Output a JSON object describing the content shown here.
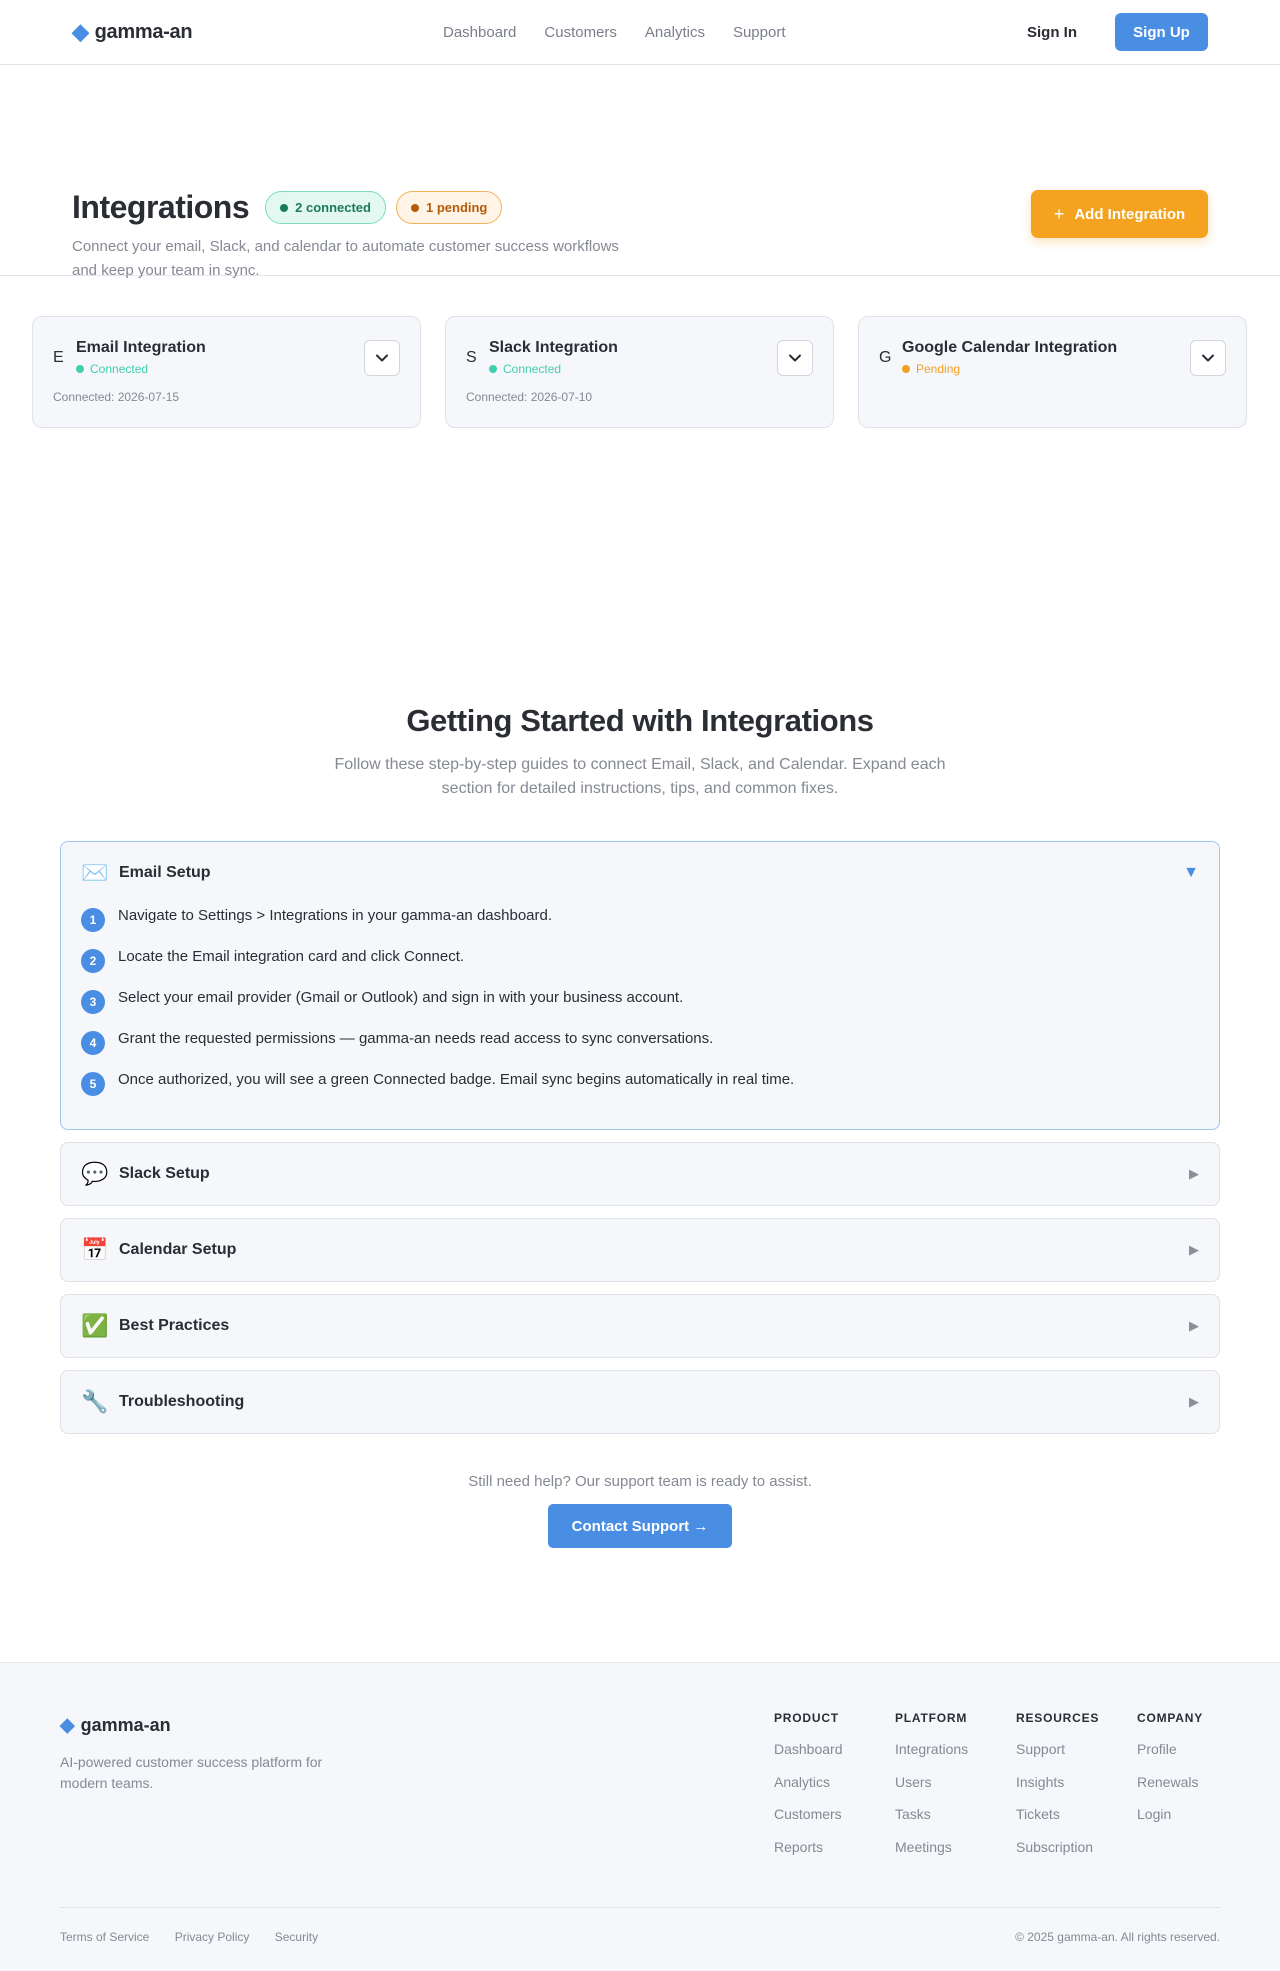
{
  "brand": {
    "name": "gamma-an",
    "accent": "#4a8ee3"
  },
  "nav": {
    "links": [
      "Dashboard",
      "Customers",
      "Analytics",
      "Support"
    ],
    "sign_in": "Sign In",
    "sign_up": "Sign Up"
  },
  "hero": {
    "title": "Integrations",
    "badge_connected": "2 connected",
    "badge_pending": "1 pending",
    "description": "Connect your email, Slack, and calendar to automate customer success workflows and keep your team in sync.",
    "add_button": "Add Integration",
    "add_button_color": "#f4a321"
  },
  "integrations": [
    {
      "letter": "E",
      "name": "Email Integration",
      "status": "Connected",
      "meta": "Connected: 2026-07-15"
    },
    {
      "letter": "S",
      "name": "Slack Integration",
      "status": "Connected",
      "meta": "Connected: 2026-07-10"
    },
    {
      "letter": "G",
      "name": "Google Calendar Integration",
      "status": "Pending",
      "meta": ""
    }
  ],
  "guides": {
    "title": "Getting Started with Integrations",
    "subtitle": "Follow these step-by-step guides to connect Email, Slack, and Calendar. Expand each section for detailed instructions, tips, and common fixes.",
    "sections": [
      {
        "icon": "envelope-icon",
        "title": "Email Setup",
        "expanded": true,
        "steps": [
          "Navigate to Settings > Integrations in your gamma-an dashboard.",
          "Locate the Email integration card and click Connect.",
          "Select your email provider (Gmail or Outlook) and sign in with your business account.",
          "Grant the requested permissions — gamma-an needs read access to sync conversations.",
          "Once authorized, you will see a green Connected badge. Email sync begins automatically in real time."
        ]
      },
      {
        "icon": "speech-bubble-icon",
        "title": "Slack Setup",
        "expanded": false
      },
      {
        "icon": "calendar-icon",
        "title": "Calendar Setup",
        "expanded": false
      },
      {
        "icon": "check-mark-icon",
        "title": "Best Practices",
        "expanded": false
      },
      {
        "icon": "wrench-icon",
        "title": "Troubleshooting",
        "expanded": false
      }
    ]
  },
  "help": {
    "text": "Still need help? Our support team is ready to assist.",
    "button": "Contact Support →"
  },
  "footer": {
    "tagline": "AI-powered customer success platform for modern teams.",
    "columns": [
      {
        "title": "PRODUCT",
        "links": [
          "Dashboard",
          "Analytics",
          "Customers",
          "Reports"
        ]
      },
      {
        "title": "PLATFORM",
        "links": [
          "Integrations",
          "Users",
          "Tasks",
          "Meetings"
        ]
      },
      {
        "title": "RESOURCES",
        "links": [
          "Support",
          "Insights",
          "Tickets",
          "Subscription"
        ]
      },
      {
        "title": "COMPANY",
        "links": [
          "Profile",
          "Renewals",
          "Login"
        ]
      }
    ],
    "legal": [
      "Terms of Service",
      "Privacy Policy",
      "Security"
    ],
    "copyright": "© 2025 gamma-an. All rights reserved."
  }
}
